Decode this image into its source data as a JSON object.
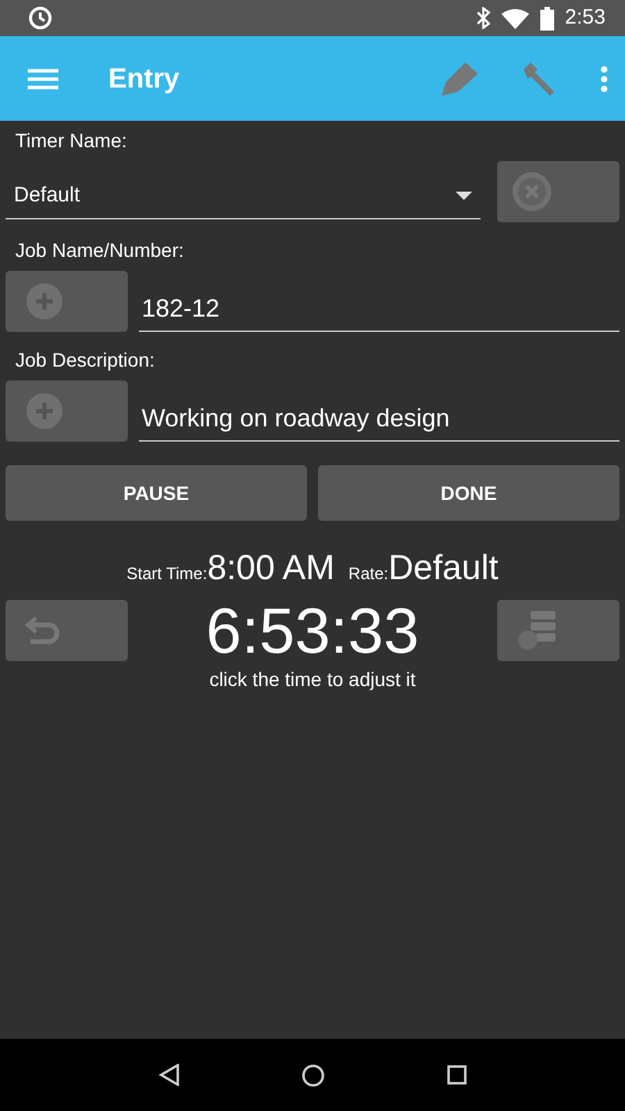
{
  "status_bar": {
    "time": "2:53"
  },
  "app_bar": {
    "title": "Entry"
  },
  "timer_name": {
    "label": "Timer Name:",
    "value": "Default"
  },
  "job_name": {
    "label": "Job Name/Number:",
    "value": "182-12"
  },
  "job_description": {
    "label": "Job Description:",
    "value": "Working on roadway design"
  },
  "buttons": [
    "PAUSE",
    "DONE"
  ],
  "timer": {
    "start_label": "Start Time:",
    "start_time": "8:00 AM",
    "rate_label": "Rate:",
    "rate": "Default",
    "elapsed": "6:53:33",
    "hint": "click the time to adjust it"
  }
}
